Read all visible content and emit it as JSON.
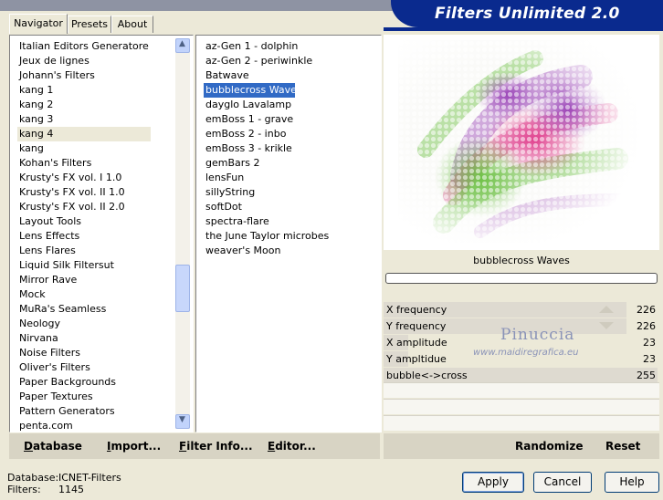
{
  "title": "Filters Unlimited 2.0",
  "tabs": [
    {
      "label": "Navigator"
    },
    {
      "label": "Presets"
    },
    {
      "label": "About"
    }
  ],
  "categories": [
    {
      "label": "Italian Editors Generatore"
    },
    {
      "label": "Jeux de lignes"
    },
    {
      "label": "Johann's Filters"
    },
    {
      "label": "kang 1"
    },
    {
      "label": "kang 2"
    },
    {
      "label": "kang 3"
    },
    {
      "label": "kang 4"
    },
    {
      "label": "kang"
    },
    {
      "label": "Kohan's Filters"
    },
    {
      "label": "Krusty's FX vol. I 1.0"
    },
    {
      "label": "Krusty's FX vol. II 1.0"
    },
    {
      "label": "Krusty's FX vol. II 2.0"
    },
    {
      "label": "Layout Tools"
    },
    {
      "label": "Lens Effects"
    },
    {
      "label": "Lens Flares"
    },
    {
      "label": "Liquid Silk Filtersut"
    },
    {
      "label": "Mirror Rave"
    },
    {
      "label": "Mock"
    },
    {
      "label": "MuRa's Seamless"
    },
    {
      "label": "Neology"
    },
    {
      "label": "Nirvana"
    },
    {
      "label": "Noise Filters"
    },
    {
      "label": "Oliver's Filters"
    },
    {
      "label": "Paper Backgrounds"
    },
    {
      "label": "Paper Textures"
    },
    {
      "label": "Pattern Generators"
    },
    {
      "label": "penta.com"
    }
  ],
  "selected_category": "kang 4",
  "filters": [
    {
      "label": "az-Gen 1  -  dolphin"
    },
    {
      "label": "az-Gen 2  -  periwinkle"
    },
    {
      "label": "Batwave"
    },
    {
      "label": "bubblecross Waves"
    },
    {
      "label": "dayglo Lavalamp"
    },
    {
      "label": "emBoss 1  -  grave"
    },
    {
      "label": "emBoss 2  -  inbo"
    },
    {
      "label": "emBoss 3  -  krikle"
    },
    {
      "label": "gemBars 2"
    },
    {
      "label": "lensFun"
    },
    {
      "label": "sillyString"
    },
    {
      "label": "softDot"
    },
    {
      "label": "spectra-flare"
    },
    {
      "label": "the June Taylor microbes"
    },
    {
      "label": "weaver's Moon"
    }
  ],
  "selected_filter": "bubblecross Waves",
  "left_buttons": {
    "database": "Database",
    "import": "Import...",
    "filter_info": "Filter Info...",
    "editor": "Editor..."
  },
  "preview": {
    "filter_name": "bubblecross Waves"
  },
  "parameters": [
    {
      "label": "X frequency",
      "value": "226",
      "fraction": 0.886
    },
    {
      "label": "Y frequency",
      "value": "226",
      "fraction": 0.886
    },
    {
      "label": "X amplitude",
      "value": "23",
      "fraction": 0.09
    },
    {
      "label": "Y ampltidue",
      "value": "23",
      "fraction": 0.09
    },
    {
      "label": "bubble<->cross",
      "value": "255",
      "fraction": 1.0
    }
  ],
  "right_buttons": {
    "randomize": "Randomize",
    "reset": "Reset"
  },
  "watermark": {
    "line1": "Pinuccia",
    "line2": "www.maidiregrafica.eu"
  },
  "status": {
    "database_label": "Database:",
    "database_value": "ICNET-Filters",
    "filters_label": "Filters:",
    "filters_value": "1145"
  },
  "dialog_buttons": {
    "apply": "Apply",
    "cancel": "Cancel",
    "help": "Help"
  },
  "colors": {
    "banner": "#0a2a8e",
    "selection": "#316ac5",
    "face": "#ece9d8"
  }
}
